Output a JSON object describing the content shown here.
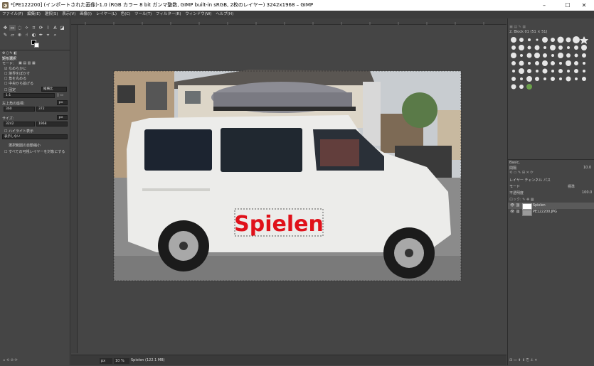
{
  "window": {
    "title": "*[PE122200] (インポートされた画像)-1.0 (RGB カラー 8 bit ガンマ整数, GIMP built-in sRGB, 2枚のレイヤー) 3242x1968 – GIMP",
    "minimize": "–",
    "maximize": "☐",
    "close": "✕"
  },
  "menu": [
    "ファイル(F)",
    "編集(E)",
    "選択(S)",
    "表示(V)",
    "画像(I)",
    "レイヤー(L)",
    "色(C)",
    "ツール(T)",
    "フィルター(R)",
    "ウィンドウ(W)",
    "ヘルプ(H)"
  ],
  "tool_options": {
    "title": "矩形選択",
    "mode_label": "モード:",
    "antialias": "なめらかに",
    "feather": "境界をぼかす",
    "rounded": "角を丸める",
    "expand_center": "中央から拡げる",
    "fixed_label": "固定",
    "fixed_value": "縦横比",
    "ratio_value": "1:1",
    "position_label": "左上角の座標:",
    "position_unit": "px",
    "pos_x": "360",
    "pos_y": "372",
    "size_label": "サイズ:",
    "size_unit": "px",
    "size_w": "3242",
    "size_h": "1968",
    "highlight": "ハイライト表示",
    "guides_value": "表示しない",
    "auto_shrink": "選択範囲の自動縮小",
    "shrink_merged": "すべての可視レイヤーを対象にする"
  },
  "canvas": {
    "image_text": "Spielen",
    "text_color": "#e0111a"
  },
  "status": {
    "unit": "px",
    "zoom": "10 %",
    "info": "Spielen (122.1 MB)"
  },
  "brushes": {
    "header": "2. Block 01 (51 × 51)",
    "preset": "Basic,",
    "spacing_label": "間隔",
    "spacing_value": "10.0"
  },
  "layers": {
    "tabs": "レイヤー  チャンネル  パス",
    "mode_label": "モード",
    "mode_value": "標準",
    "opacity_label": "不透明度",
    "opacity_value": "100.0",
    "items": [
      {
        "name": "Spielen"
      },
      {
        "name": "PE122200.JPG"
      }
    ]
  }
}
